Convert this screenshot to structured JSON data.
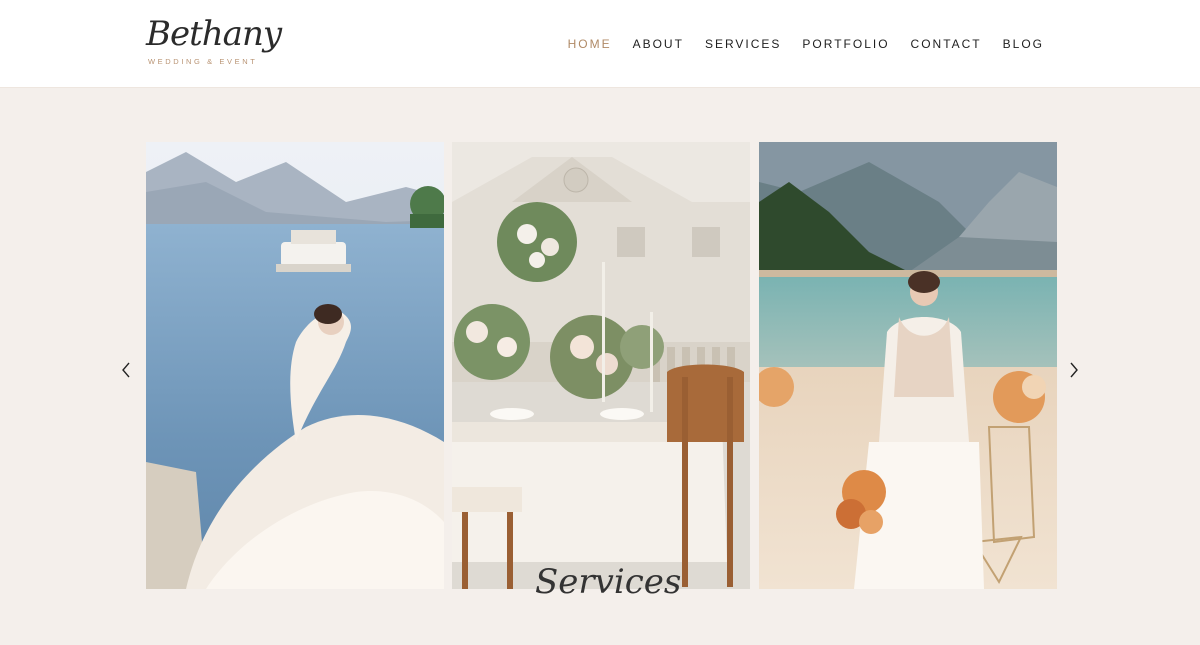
{
  "brand": {
    "name": "Bethany",
    "tagline": "WEDDING & EVENT"
  },
  "nav": {
    "items": [
      {
        "label": "HOME",
        "active": true
      },
      {
        "label": "ABOUT",
        "active": false
      },
      {
        "label": "SERVICES",
        "active": false
      },
      {
        "label": "PORTFOLIO",
        "active": false
      },
      {
        "label": "CONTACT",
        "active": false
      },
      {
        "label": "BLOG",
        "active": false
      }
    ]
  },
  "colors": {
    "accent": "#b08a66",
    "background": "#f4efeb",
    "header_bg": "#ffffff",
    "text": "#1f1f1f"
  },
  "slider": {
    "prev_icon": "chevron-left-icon",
    "next_icon": "chevron-right-icon",
    "slides": [
      {
        "subject": "bride-by-lake-photo",
        "caption": ""
      },
      {
        "subject": "wedding-table-photo",
        "caption": "Services"
      },
      {
        "subject": "bride-with-bouquet-photo",
        "caption": ""
      }
    ]
  }
}
